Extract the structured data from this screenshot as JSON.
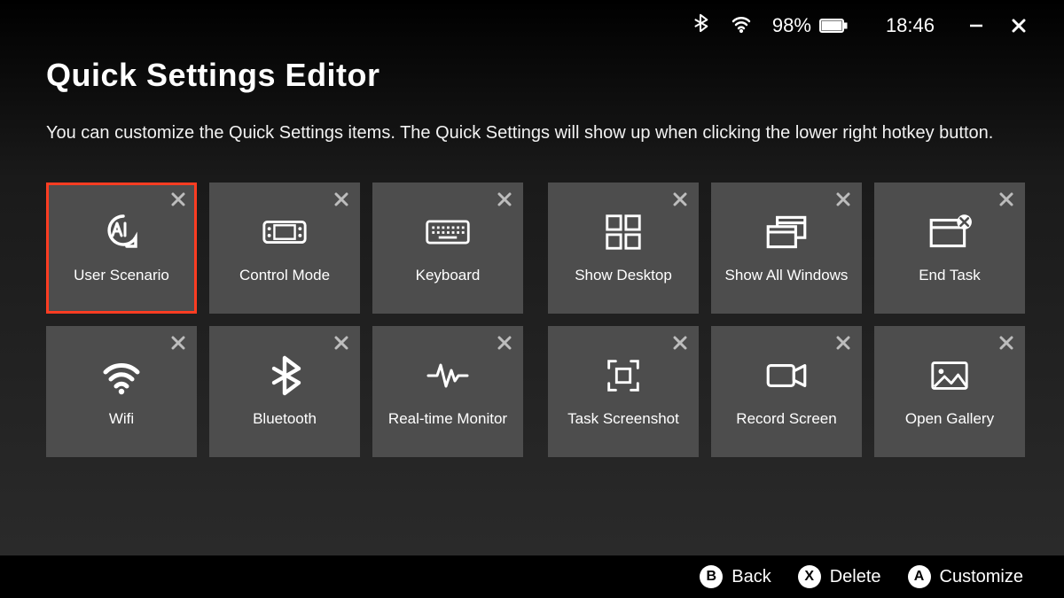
{
  "status": {
    "battery_percent": "98%",
    "time": "18:46"
  },
  "header": {
    "title": "Quick Settings Editor",
    "subtitle": "You can customize the Quick Settings items. The Quick Settings will show up when clicking the lower right hotkey button."
  },
  "group1": [
    {
      "id": "user-scenario",
      "label": "User Scenario",
      "selected": true
    },
    {
      "id": "control-mode",
      "label": "Control Mode",
      "selected": false
    },
    {
      "id": "keyboard",
      "label": "Keyboard",
      "selected": false
    },
    {
      "id": "wifi",
      "label": "Wifi",
      "selected": false
    },
    {
      "id": "bluetooth",
      "label": "Bluetooth",
      "selected": false
    },
    {
      "id": "realtime-monitor",
      "label": "Real-time Monitor",
      "selected": false
    }
  ],
  "group2": [
    {
      "id": "show-desktop",
      "label": "Show Desktop",
      "selected": false
    },
    {
      "id": "show-all-windows",
      "label": "Show All Windows",
      "selected": false
    },
    {
      "id": "end-task",
      "label": "End Task",
      "selected": false
    },
    {
      "id": "task-screenshot",
      "label": "Task Screenshot",
      "selected": false
    },
    {
      "id": "record-screen",
      "label": "Record Screen",
      "selected": false
    },
    {
      "id": "open-gallery",
      "label": "Open Gallery",
      "selected": false
    }
  ],
  "footer": {
    "back": {
      "key": "B",
      "label": "Back"
    },
    "delete": {
      "key": "X",
      "label": "Delete"
    },
    "customize": {
      "key": "A",
      "label": "Customize"
    }
  }
}
